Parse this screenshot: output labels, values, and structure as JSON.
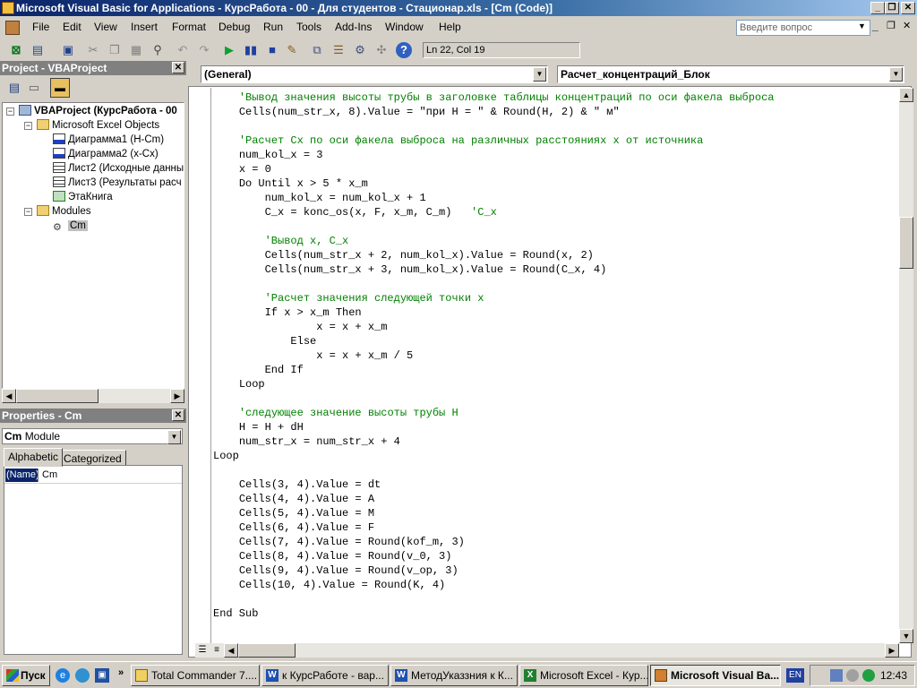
{
  "window": {
    "title": "Microsoft Visual Basic for Applications - КурсРабота - 00 - Для студентов - Стационар.xls - [Cm (Code)]",
    "min": "_",
    "max": "□",
    "close": "✕"
  },
  "menu": {
    "items": [
      {
        "label": "File"
      },
      {
        "label": "Edit"
      },
      {
        "label": "View"
      },
      {
        "label": "Insert"
      },
      {
        "label": "Format"
      },
      {
        "label": "Debug"
      },
      {
        "label": "Run"
      },
      {
        "label": "Tools"
      },
      {
        "label": "Add-Ins"
      },
      {
        "label": "Window"
      },
      {
        "label": "Help"
      }
    ],
    "help_placeholder": "Введите вопрос"
  },
  "toolbar": {
    "position": "Ln 22, Col 19"
  },
  "project": {
    "title": "Project - VBAProject",
    "root": "VBAProject (КурсРабота - 00",
    "folder_objects": "Microsoft Excel Objects",
    "items": [
      "Диаграмма1 (H-Cm)",
      "Диаграмма2 (x-Cx)",
      "Лист2 (Исходные данны",
      "Лист3 (Результаты расч",
      "ЭтаКнига"
    ],
    "folder_modules": "Modules",
    "module": "Cm"
  },
  "properties": {
    "title": "Properties - Cm",
    "object_name": "Cm",
    "object_type": "Module",
    "tab_alphabetic": "Alphabetic",
    "tab_categorized": "Categorized",
    "prop_name": "(Name)",
    "prop_value": "Cm"
  },
  "code": {
    "object_dropdown": "(General)",
    "proc_dropdown": "Расчет_концентраций_Блок",
    "lines": [
      {
        "indent": "    ",
        "text": "'Вывод значения высоты трубы в заголовке таблицы концентраций по оси факела выброса",
        "kind": "comment"
      },
      {
        "indent": "    ",
        "text": "Cells(num_str_x, 8).Value = \"при H = \" & Round(H, 2) & \" м\"",
        "kind": "code"
      },
      {
        "indent": "",
        "text": "",
        "kind": "code"
      },
      {
        "indent": "    ",
        "text": "'Расчет Cx по оси факела выброса на различных расстояниях x от источника",
        "kind": "comment"
      },
      {
        "indent": "    ",
        "text": "num_kol_x = 3",
        "kind": "code"
      },
      {
        "indent": "    ",
        "text": "x = 0",
        "kind": "code"
      },
      {
        "indent": "    ",
        "text": "Do Until x > 5 * x_m",
        "kind": "code"
      },
      {
        "indent": "        ",
        "text": "num_kol_x = num_kol_x + 1",
        "kind": "code"
      },
      {
        "indent": "        ",
        "text": "C_x = konc_os(x, F, x_m, C_m)   ",
        "kind": "code",
        "comment": "'C_x"
      },
      {
        "indent": "",
        "text": "",
        "kind": "code"
      },
      {
        "indent": "        ",
        "text": "'Вывод x, C_x",
        "kind": "comment"
      },
      {
        "indent": "        ",
        "text": "Cells(num_str_x + 2, num_kol_x).Value = Round(x, 2)",
        "kind": "code"
      },
      {
        "indent": "        ",
        "text": "Cells(num_str_x + 3, num_kol_x).Value = Round(C_x, 4)",
        "kind": "code"
      },
      {
        "indent": "",
        "text": "",
        "kind": "code"
      },
      {
        "indent": "        ",
        "text": "'Расчет значения следующей точки x",
        "kind": "comment"
      },
      {
        "indent": "        ",
        "text": "If x > x_m Then",
        "kind": "code"
      },
      {
        "indent": "                ",
        "text": "x = x + x_m",
        "kind": "code"
      },
      {
        "indent": "            ",
        "text": "Else",
        "kind": "code"
      },
      {
        "indent": "                ",
        "text": "x = x + x_m / 5",
        "kind": "code"
      },
      {
        "indent": "        ",
        "text": "End If",
        "kind": "code"
      },
      {
        "indent": "    ",
        "text": "Loop",
        "kind": "code"
      },
      {
        "indent": "",
        "text": "",
        "kind": "code"
      },
      {
        "indent": "    ",
        "text": "'следующее значение высоты трубы H",
        "kind": "comment"
      },
      {
        "indent": "    ",
        "text": "H = H + dH",
        "kind": "code"
      },
      {
        "indent": "    ",
        "text": "num_str_x = num_str_x + 4",
        "kind": "code"
      },
      {
        "indent": "",
        "text": "Loop",
        "kind": "code"
      },
      {
        "indent": "",
        "text": "",
        "kind": "code"
      },
      {
        "indent": "    ",
        "text": "Cells(3, 4).Value = dt",
        "kind": "code"
      },
      {
        "indent": "    ",
        "text": "Cells(4, 4).Value = A",
        "kind": "code"
      },
      {
        "indent": "    ",
        "text": "Cells(5, 4).Value = M",
        "kind": "code"
      },
      {
        "indent": "    ",
        "text": "Cells(6, 4).Value = F",
        "kind": "code"
      },
      {
        "indent": "    ",
        "text": "Cells(7, 4).Value = Round(kof_m, 3)",
        "kind": "code"
      },
      {
        "indent": "    ",
        "text": "Cells(8, 4).Value = Round(v_0, 3)",
        "kind": "code"
      },
      {
        "indent": "    ",
        "text": "Cells(9, 4).Value = Round(v_op, 3)",
        "kind": "code"
      },
      {
        "indent": "    ",
        "text": "Cells(10, 4).Value = Round(K, 4)",
        "kind": "code"
      },
      {
        "indent": "",
        "text": "",
        "kind": "code"
      },
      {
        "indent": "",
        "text": "End Sub",
        "kind": "code"
      }
    ]
  },
  "taskbar": {
    "start": "Пуск",
    "tasks": [
      {
        "label": "Total Commander 7...."
      },
      {
        "label": "к КурсРаботе - вар..."
      },
      {
        "label": "МетодУказзния к К..."
      },
      {
        "label": "Microsoft Excel - Кур..."
      },
      {
        "label": "Microsoft Visual Ba..."
      }
    ],
    "lang": "EN",
    "clock": "12:43"
  },
  "colors": {
    "comment": "#008000",
    "keyword": "#000080",
    "title_start": "#0a246a",
    "panel_header": "#808080"
  }
}
